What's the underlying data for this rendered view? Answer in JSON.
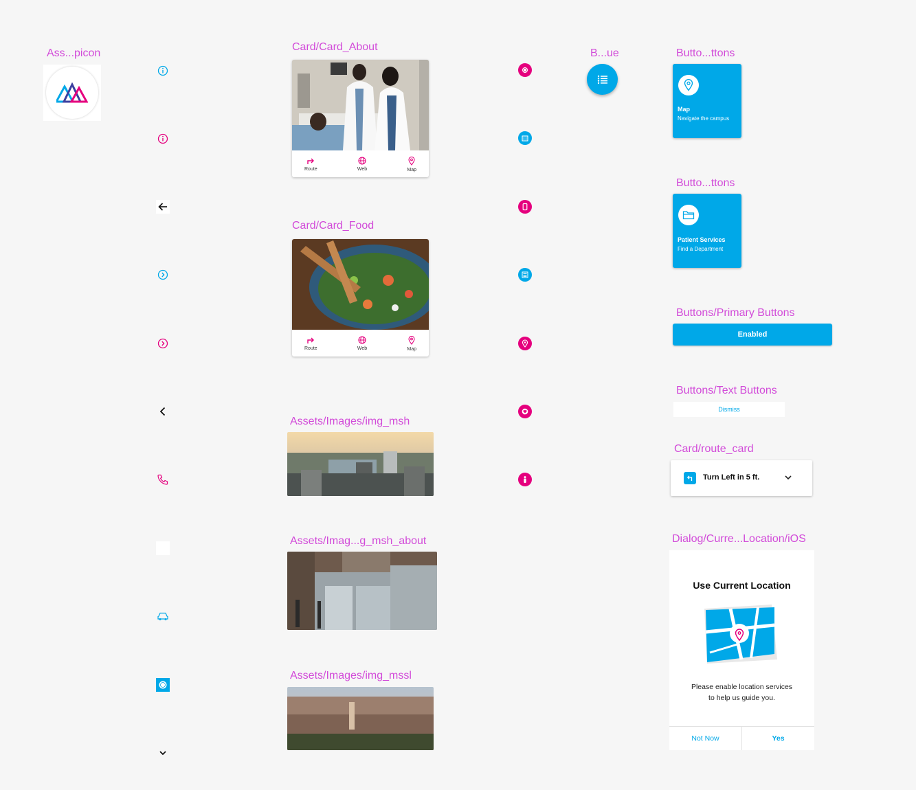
{
  "labels": {
    "appicon": "Ass...picon",
    "card_about": "Card/Card_About",
    "card_food": "Card/Card_Food",
    "img_msh": "Assets/Images/img_msh",
    "img_msh_about": "Assets/Imag...g_msh_about",
    "img_mssl": "Assets/Images/img_mssl",
    "fab": "B...ue",
    "tile_map": "Butto...ttons",
    "tile_patient": "Butto...ttons",
    "primary_buttons": "Buttons/Primary Buttons",
    "text_buttons": "Buttons/Text Buttons",
    "route_card": "Card/route_card",
    "dialog": "Dialog/Curre...Location/iOS"
  },
  "card_actions": {
    "route": "Route",
    "web": "Web",
    "map": "Map"
  },
  "tiles": {
    "map": {
      "title": "Map",
      "subtitle": "Navigate the campus"
    },
    "patient": {
      "title": "Patient Services",
      "subtitle": "Find a Department"
    }
  },
  "primary_button": {
    "label": "Enabled"
  },
  "text_button": {
    "label": "Dismiss"
  },
  "route_card": {
    "text": "Turn Left in 5 ft."
  },
  "dialog": {
    "title": "Use Current Location",
    "message_line1": "Please enable location services",
    "message_line2": "to help us guide you.",
    "not_now": "Not Now",
    "yes": "Yes"
  },
  "colors": {
    "label": "#d24bd9",
    "blue": "#00a8e8",
    "pink": "#e5007e",
    "background": "#f6f6f6"
  }
}
